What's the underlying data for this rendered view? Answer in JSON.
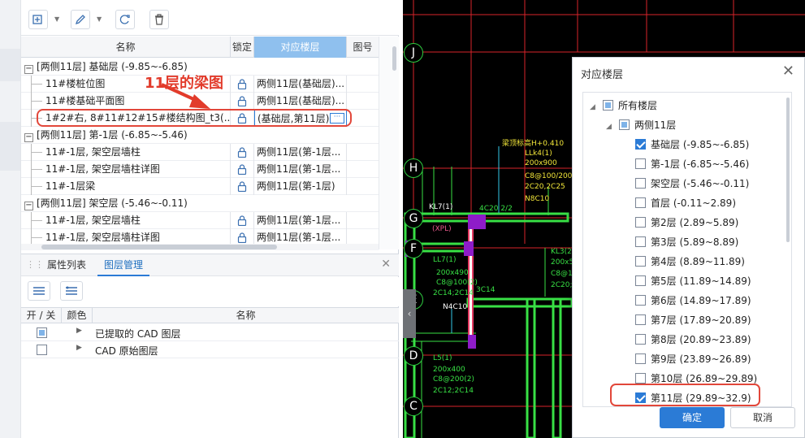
{
  "annotation": "11层的梁图",
  "grid": {
    "headers": {
      "name": "名称",
      "lock": "锁定",
      "floor": "对应楼层",
      "num": "图号"
    },
    "rows": [
      {
        "type": "group",
        "text": "[两侧11层] 基础层 (-9.85~-6.85)"
      },
      {
        "type": "leaf",
        "name": "11#楼桩位图",
        "floor": "两侧11层(基础层)..."
      },
      {
        "type": "leaf",
        "name": "11#楼基础平面图",
        "floor": "两侧11层(基础层)..."
      },
      {
        "type": "leaf",
        "name": "1#2#右, 8#11#12#15#楼结构图_t3(...",
        "floor": "(基础层,第11层)",
        "editing": true
      },
      {
        "type": "group",
        "text": "[两侧11层] 第-1层 (-6.85~-5.46)"
      },
      {
        "type": "leaf",
        "name": "11#-1层, 架空层墙柱",
        "floor": "两侧11层(第-1层..."
      },
      {
        "type": "leaf",
        "name": "11#-1层, 架空层墙柱详图",
        "floor": "两侧11层(第-1层..."
      },
      {
        "type": "leaf",
        "name": "11#-1层梁",
        "floor": "两侧11层(第-1层)"
      },
      {
        "type": "group",
        "text": "[两侧11层] 架空层 (-5.46~-0.11)"
      },
      {
        "type": "leaf",
        "name": "11#-1层, 架空层墙柱",
        "floor": "两侧11层(第-1层..."
      },
      {
        "type": "leaf",
        "name": "11#-1层, 架空层墙柱详图",
        "floor": "两侧11层(第-1层..."
      }
    ]
  },
  "tabs": {
    "properties": "属性列表",
    "layers": "图层管理"
  },
  "layers": {
    "headers": {
      "toggle": "开 / 关",
      "color": "颜色",
      "name": "名称"
    },
    "rows": [
      {
        "name": "已提取的 CAD 图层",
        "state": "partial"
      },
      {
        "name": "CAD 原始图层",
        "state": "off"
      }
    ]
  },
  "cad": {
    "axes": [
      "J",
      "H",
      "G",
      "F",
      "E",
      "D",
      "C"
    ],
    "texts": {
      "kl7": "KL7(1)",
      "xpl": "(XPL)",
      "size1": "200x490",
      "stir1": "C8@100(2)",
      "bars1": "2C14;2C14",
      "ll7": "LL7(1)",
      "size2": "200x490",
      "stir2": "C8@100(2)",
      "bars2": "2C14;2C14",
      "n4c10": "N4C10",
      "l5": "L5(1)",
      "size3": "200x400",
      "stir3": "C8@200(2)",
      "bars3": "2C12;2C14",
      "c4c20": "4C20 2/2",
      "c3c14": "3C14",
      "ll4": "LLk4(1)",
      "size4": "200x900",
      "stir4": "C8@100/200(2)",
      "bars4": "2C20,2C25",
      "n8c10": "N8C10",
      "lvl": "梁顶标高H+0.410",
      "kl3": "KL3(2)",
      "size5": "200x5",
      "stir5": "C8@10",
      "bars5": "2C20;"
    }
  },
  "dialog": {
    "title": "对应楼层",
    "root": "所有楼层",
    "building": "两侧11层",
    "floors": [
      {
        "label": "基础层 (-9.85~-6.85)",
        "checked": true
      },
      {
        "label": "第-1层 (-6.85~-5.46)",
        "checked": false
      },
      {
        "label": "架空层 (-5.46~-0.11)",
        "checked": false
      },
      {
        "label": "首层 (-0.11~2.89)",
        "checked": false
      },
      {
        "label": "第2层 (2.89~5.89)",
        "checked": false
      },
      {
        "label": "第3层 (5.89~8.89)",
        "checked": false
      },
      {
        "label": "第4层 (8.89~11.89)",
        "checked": false
      },
      {
        "label": "第5层 (11.89~14.89)",
        "checked": false
      },
      {
        "label": "第6层 (14.89~17.89)",
        "checked": false
      },
      {
        "label": "第7层 (17.89~20.89)",
        "checked": false
      },
      {
        "label": "第8层 (20.89~23.89)",
        "checked": false
      },
      {
        "label": "第9层 (23.89~26.89)",
        "checked": false
      },
      {
        "label": "第10层 (26.89~29.89)",
        "checked": false
      },
      {
        "label": "第11层 (29.89~32.9)",
        "checked": true
      }
    ],
    "ok": "确定",
    "cancel": "取消"
  }
}
